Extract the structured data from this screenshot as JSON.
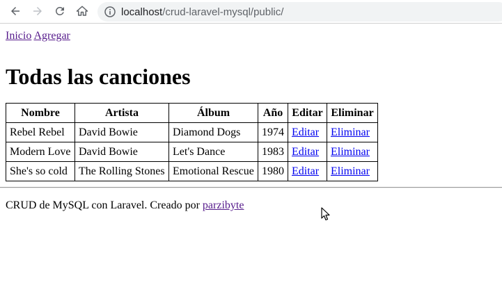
{
  "browser": {
    "url_host": "localhost",
    "url_path": "/crud-laravel-mysql/public/"
  },
  "nav": {
    "home_label": "Inicio",
    "add_label": "Agregar"
  },
  "page_title": "Todas las canciones",
  "table": {
    "headers": [
      "Nombre",
      "Artista",
      "Álbum",
      "Año",
      "Editar",
      "Eliminar"
    ],
    "rows": [
      {
        "nombre": "Rebel Rebel",
        "artista": "David Bowie",
        "album": "Diamond Dogs",
        "anio": "1974",
        "editar": "Editar",
        "eliminar": "Eliminar"
      },
      {
        "nombre": "Modern Love",
        "artista": "David Bowie",
        "album": "Let's Dance",
        "anio": "1983",
        "editar": "Editar",
        "eliminar": "Eliminar"
      },
      {
        "nombre": "She's so cold",
        "artista": "The Rolling Stones",
        "album": "Emotional Rescue",
        "anio": "1980",
        "editar": "Editar",
        "eliminar": "Eliminar"
      }
    ]
  },
  "footer": {
    "text": "CRUD de MySQL con Laravel. Creado por ",
    "author_link": "parzibyte"
  },
  "colors": {
    "visited_link": "#551a8b",
    "link": "#0000ee"
  }
}
